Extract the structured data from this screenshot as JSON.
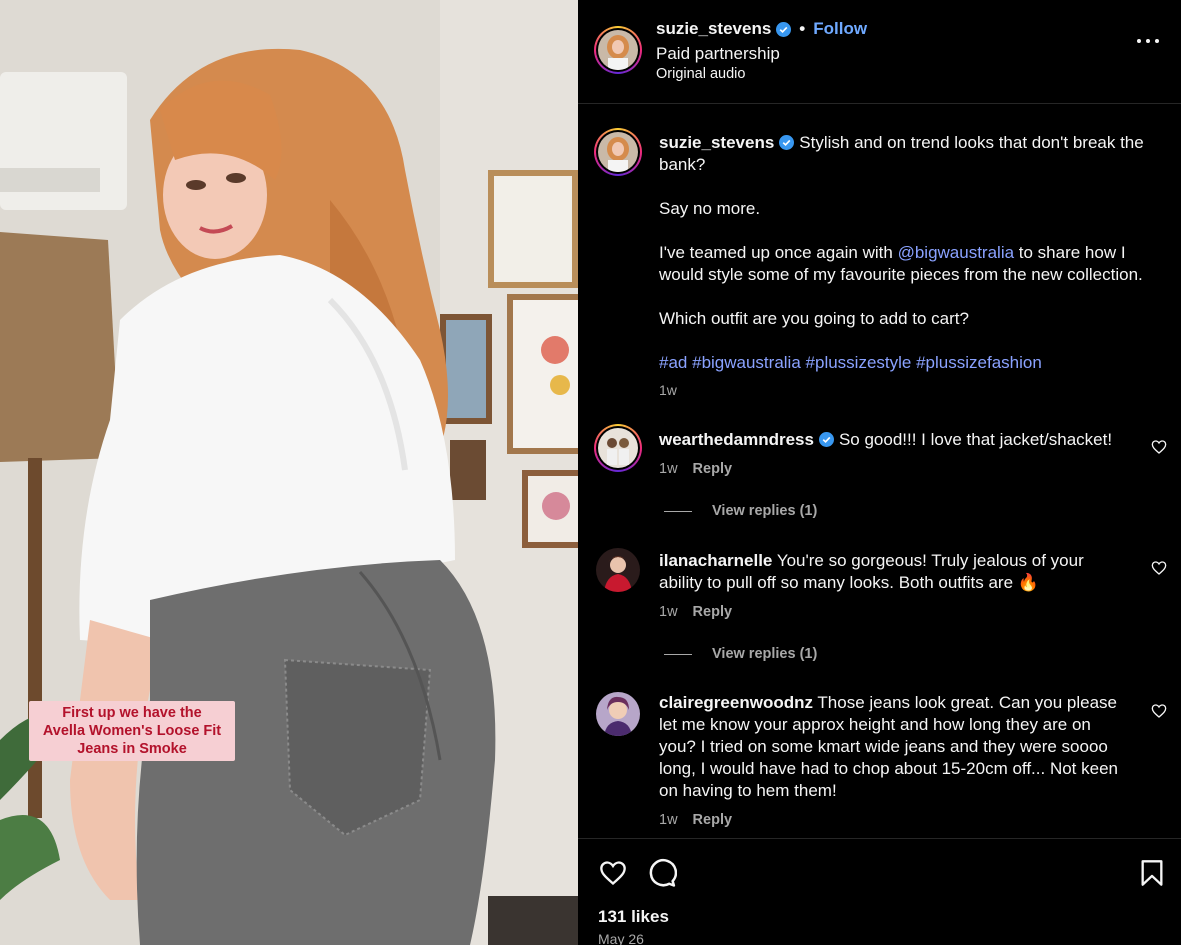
{
  "post": {
    "username": "suzie_stevens",
    "separator": "•",
    "follow_label": "Follow",
    "partnership": "Paid partnership",
    "audio": "Original audio",
    "more_icon": "more-options-icon"
  },
  "media": {
    "sticker_line1": "First up we have the",
    "sticker_line2": "Avella Women's Loose Fit",
    "sticker_line3": "Jeans in Smoke"
  },
  "caption": {
    "username": "suzie_stevens",
    "line1": "Stylish and on trend looks that don't break the bank?",
    "line2": "Say no more.",
    "line3_pre": "I've teamed up once again with ",
    "line3_mention": "@bigwaustralia",
    "line3_post": " to share how I would style some of my favourite pieces from the new collection.",
    "line4": "Which outfit are you going to add to cart?",
    "tags": [
      "#ad",
      "#bigwaustralia",
      "#plussizestyle",
      "#plussizefashion"
    ],
    "time": "1w"
  },
  "comments": [
    {
      "username": "wearthedamndress",
      "verified": true,
      "text": "So good!!! I love that jacket/shacket!",
      "time": "1w",
      "reply_label": "Reply",
      "view_replies": "View replies (1)"
    },
    {
      "username": "ilanacharnelle",
      "verified": false,
      "text": "You're so gorgeous! Truly jealous of your ability to pull off so many looks. Both outfits are 🔥",
      "time": "1w",
      "reply_label": "Reply",
      "view_replies": "View replies (1)"
    },
    {
      "username": "clairegreenwoodnz",
      "verified": false,
      "text": "Those jeans look great. Can you please let me know your approx height and how long they are on you? I tried on some kmart wide jeans and they were soooo long, I would have had to chop about 15-20cm off... Not keen on having to hem them!",
      "time": "1w",
      "reply_label": "Reply"
    }
  ],
  "footer": {
    "likes": "131 likes",
    "date": "May 26"
  },
  "colors": {
    "background": "#000000",
    "link": "#8aa2ff",
    "follow": "#6fa9ff",
    "muted": "#a8a8a8",
    "verified": "#3897f0",
    "sticker_bg": "#f6cfd3",
    "sticker_text": "#b3122b"
  }
}
